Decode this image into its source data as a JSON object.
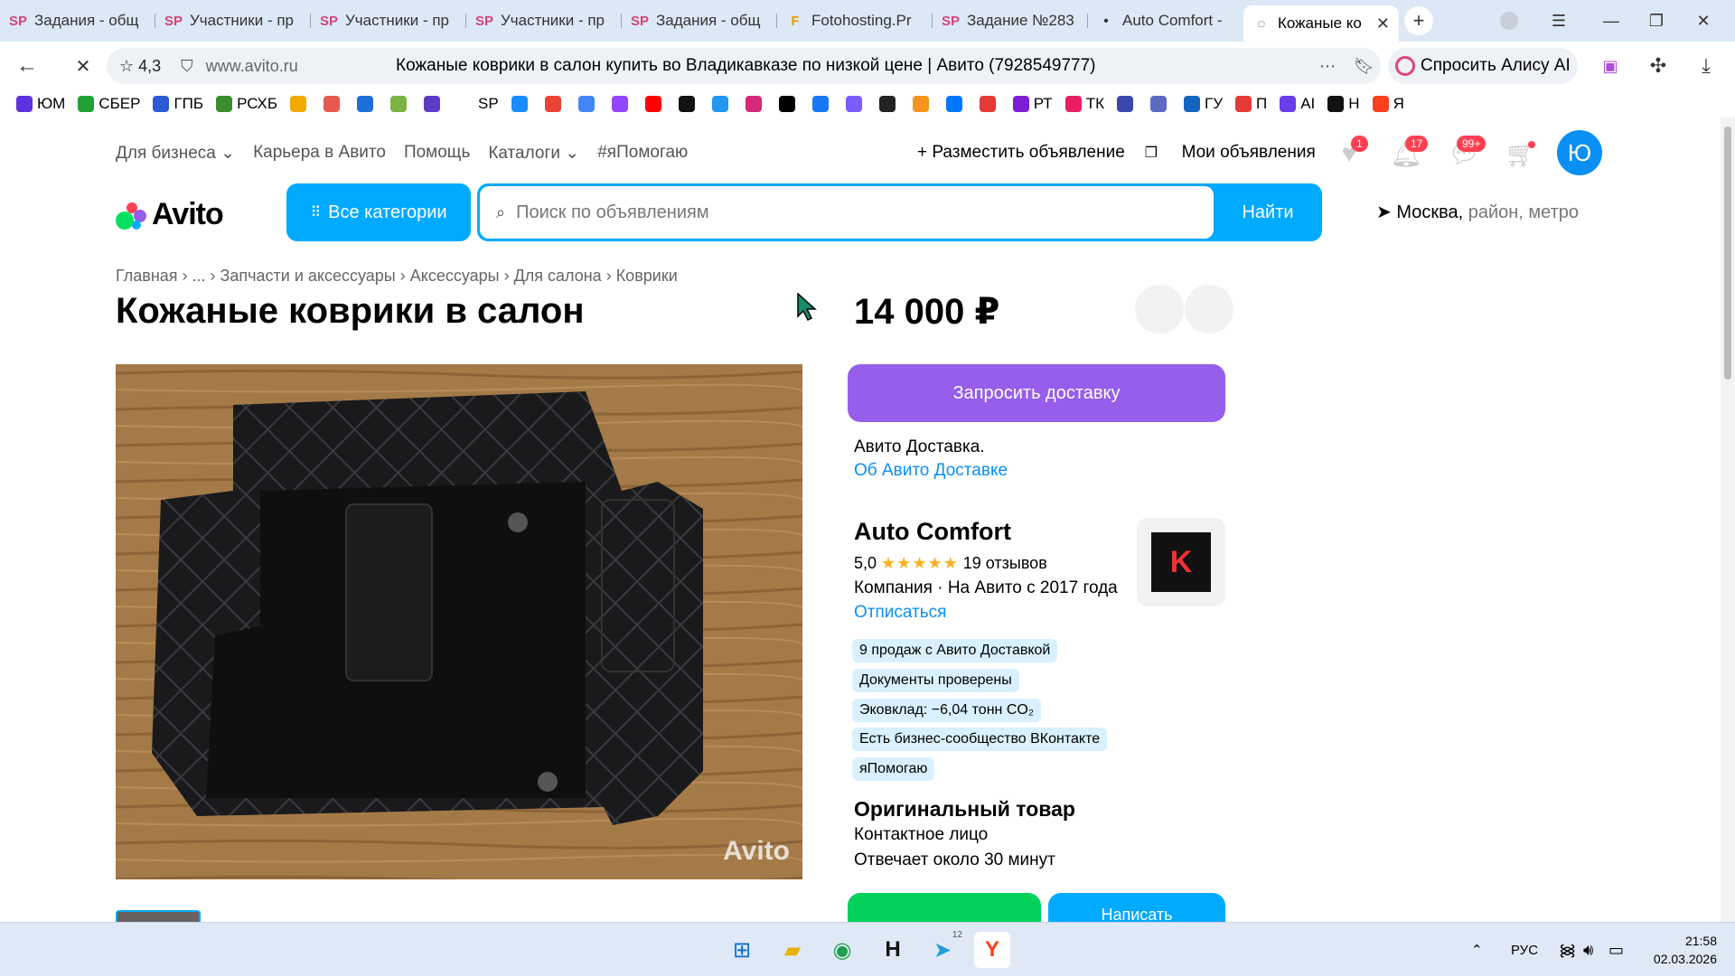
{
  "browser": {
    "tabs": [
      {
        "icon": "SP",
        "label": "Задания - общ"
      },
      {
        "icon": "SP",
        "label": "Участники - пр"
      },
      {
        "icon": "SP",
        "label": "Участники - пр"
      },
      {
        "icon": "SP",
        "label": "Участники - пр"
      },
      {
        "icon": "SP",
        "label": "Задания - общ"
      },
      {
        "icon": "F",
        "label": "Fotohosting.Pr"
      },
      {
        "icon": "SP",
        "label": "Задание №283"
      },
      {
        "icon": "•",
        "label": "Auto Comfort -"
      },
      {
        "icon": "◌",
        "label": "Кожаные ко"
      }
    ],
    "rating": "4,3",
    "domain": "www.avito.ru",
    "page_title": "Кожаные коврики в салон купить во Владикавказе по низкой цене | Авито (7928549777)",
    "alisa_label": "Спросить Алису AI",
    "bookmarks": [
      {
        "label": "ЮМ",
        "color": "#5a32e0"
      },
      {
        "label": "СБЕР",
        "color": "#21a038"
      },
      {
        "label": "ГПБ",
        "color": "#2b5cd6"
      },
      {
        "label": "РСХБ",
        "color": "#3c8d2f"
      },
      {
        "label": "",
        "color": "#f2a900"
      },
      {
        "label": "",
        "color": "#e85a4f"
      },
      {
        "label": "",
        "color": "#1e6fd9"
      },
      {
        "label": "",
        "color": "#7cb342"
      },
      {
        "label": "",
        "color": "#5b3cc4"
      },
      {
        "label": "SP",
        "color": "#ffffff"
      },
      {
        "label": "",
        "color": "#1a8cff"
      },
      {
        "label": "",
        "color": "#ea4335"
      },
      {
        "label": "",
        "color": "#4285f4"
      },
      {
        "label": "",
        "color": "#9146ff"
      },
      {
        "label": "",
        "color": "#ff0000"
      },
      {
        "label": "",
        "color": "#111111"
      },
      {
        "label": "",
        "color": "#2196f3"
      },
      {
        "label": "",
        "color": "#d62976"
      },
      {
        "label": "",
        "color": "#000000"
      },
      {
        "label": "",
        "color": "#1877f2"
      },
      {
        "label": "",
        "color": "#7b5cff"
      },
      {
        "label": "",
        "color": "#222222"
      },
      {
        "label": "",
        "color": "#f7931e"
      },
      {
        "label": "",
        "color": "#0077ff"
      },
      {
        "label": "",
        "color": "#e53935"
      },
      {
        "label": "РТ",
        "color": "#7a1fd6"
      },
      {
        "label": "ТК",
        "color": "#e91e63"
      },
      {
        "label": "",
        "color": "#3949ab"
      },
      {
        "label": "",
        "color": "#5c6bc0"
      },
      {
        "label": "ГУ",
        "color": "#1565c0"
      },
      {
        "label": "П",
        "color": "#e53935"
      },
      {
        "label": "AI",
        "color": "#6a3de8"
      },
      {
        "label": "Н",
        "color": "#111111"
      },
      {
        "label": "Я",
        "color": "#fc3f1d"
      }
    ]
  },
  "site": {
    "top_nav": [
      "Для бизнеса ⌄",
      "Карьера в Авито",
      "Помощь",
      "Каталоги ⌄",
      "#яПомогаю"
    ],
    "post_ad": "+ Разместить объявление",
    "my_ads": "Мои объявления",
    "badges": {
      "favorites": "1",
      "notifications": "17",
      "messages": "99+"
    },
    "avatar_letter": "Ю",
    "logo": "Avito",
    "categories_btn": "Все категории",
    "search_placeholder": "Поиск по объявлениям",
    "search_btn": "Найти",
    "location_city": "Москва,",
    "location_rest": " район, метро"
  },
  "listing": {
    "breadcrumbs": "Главная › ... › Запчасти и аксессуары › Аксессуары › Для салона › Коврики",
    "title": "Кожаные коврики в салон",
    "price": "14 000 ₽",
    "photo_watermark": "Avito",
    "delivery_btn": "Запросить доставку",
    "delivery_text": "Авито Доставка.",
    "delivery_link": "Об Авито Доставке"
  },
  "seller": {
    "name": "Auto Comfort",
    "rating": "5,0",
    "stars": "★★★★★",
    "reviews": "19 отзывов",
    "info": "Компания · На Авито с 2017 года",
    "unsubscribe": "Отписаться",
    "tags": [
      "9 продаж с Авито Доставкой",
      "Документы проверены",
      "Эковклад: −6,04 тонн CO₂",
      "Есть бизнес-сообщество ВКонтакте",
      "яПомогаю"
    ],
    "original": "Оригинальный товар",
    "contact_person": "Контактное лицо",
    "response_time": "Отвечает около 30 минут",
    "write_btn": "Написать"
  },
  "taskbar": {
    "lang": "РУС",
    "time": "21:58",
    "date": "02.03.2026",
    "telegram_badge": "12"
  }
}
